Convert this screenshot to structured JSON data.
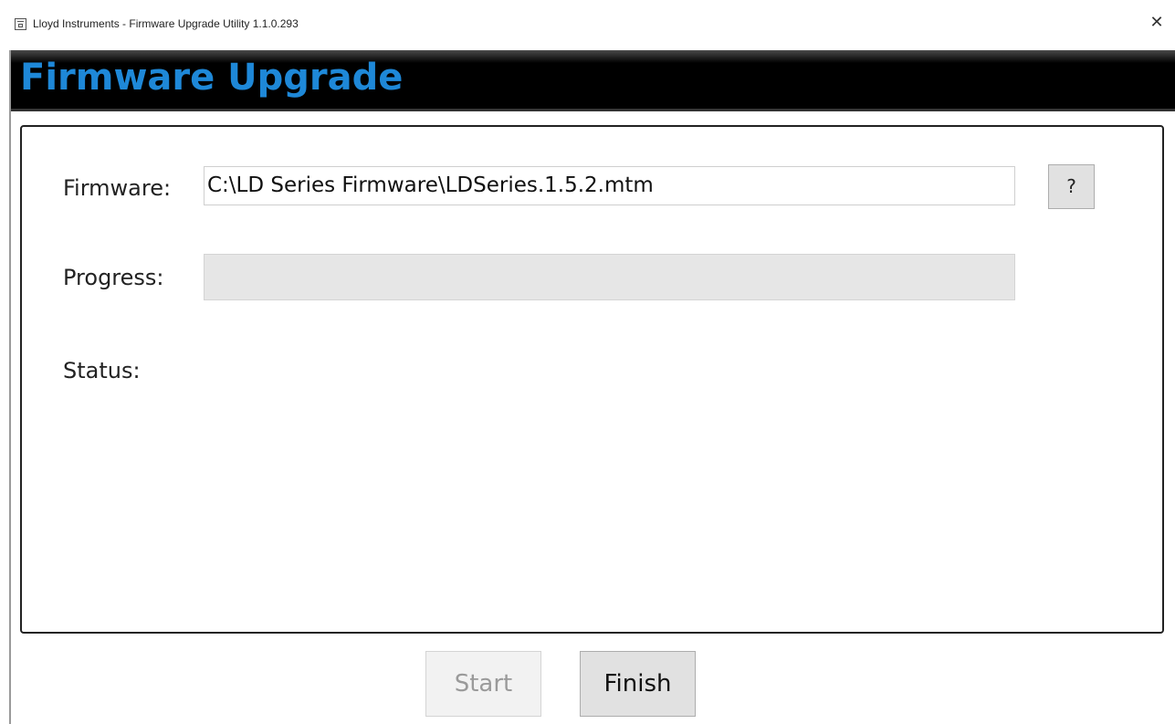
{
  "window": {
    "title": "Lloyd Instruments - Firmware Upgrade Utility 1.1.0.293",
    "icon": "app-window-icon",
    "close_label": "✕"
  },
  "header": {
    "title": "Firmware Upgrade",
    "title_color": "#1e88d8"
  },
  "form": {
    "firmware_label": "Firmware:",
    "firmware_value": "C:\\LD Series Firmware\\LDSeries.1.5.2.mtm",
    "help_label": "?",
    "progress_label": "Progress:",
    "progress_value": 0,
    "status_label": "Status:",
    "status_value": ""
  },
  "buttons": {
    "start_label": "Start",
    "start_enabled": false,
    "finish_label": "Finish"
  }
}
